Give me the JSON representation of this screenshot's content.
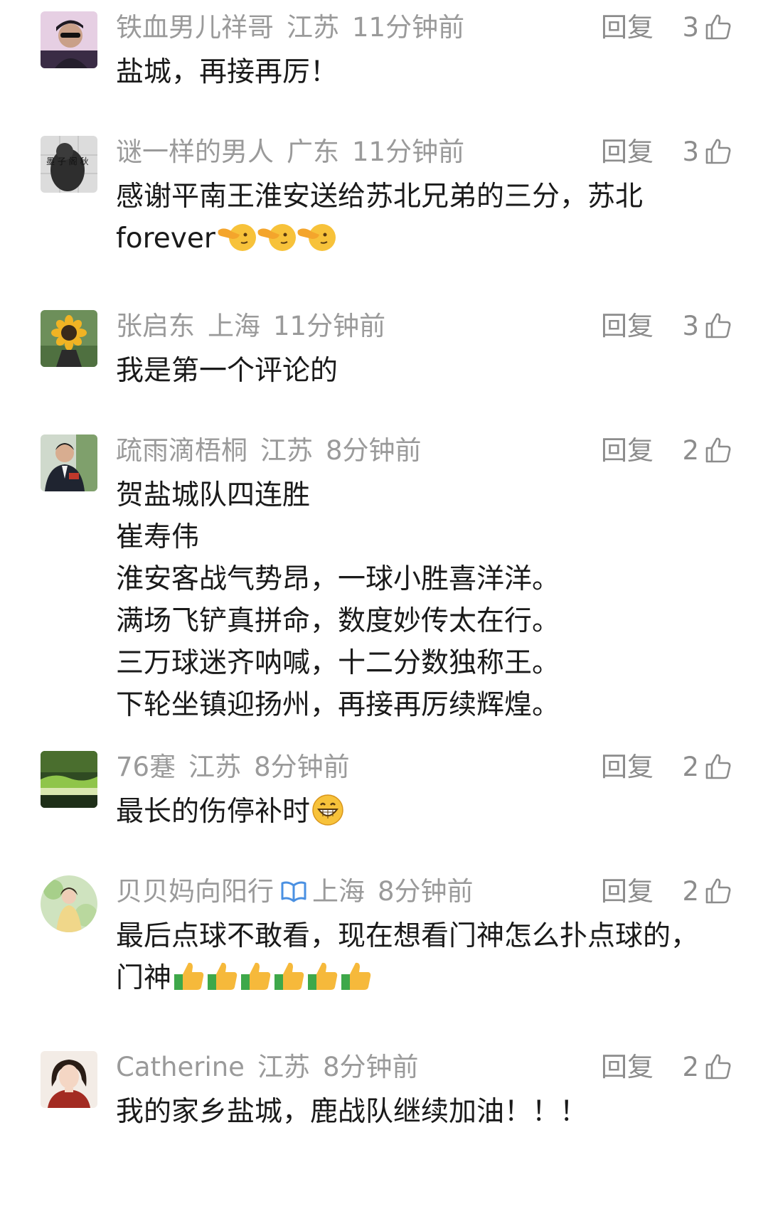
{
  "comments": [
    {
      "user": "铁血男儿祥哥",
      "location": "江苏",
      "time": "11分钟前",
      "reply_label": "回复",
      "likes": "3",
      "lines": [
        "盐城，再接再厉！"
      ]
    },
    {
      "user": "谜一样的男人",
      "location": "广东",
      "time": "11分钟前",
      "reply_label": "回复",
      "likes": "3",
      "lines": [
        "感谢平南王淮安送给苏北兄弟的三分，苏北",
        "forever"
      ],
      "emoji": "pointing-face-emoji ×3"
    },
    {
      "user": "张启东",
      "location": "上海",
      "time": "11分钟前",
      "reply_label": "回复",
      "likes": "3",
      "lines": [
        "我是第一个评论的"
      ]
    },
    {
      "user": "疏雨滴梧桐",
      "location": "江苏",
      "time": "8分钟前",
      "reply_label": "回复",
      "likes": "2",
      "lines": [
        "贺盐城队四连胜",
        "崔寿伟",
        "淮安客战气势昂，一球小胜喜洋洋。",
        "满场飞铲真拼命，数度妙传太在行。",
        "三万球迷齐呐喊，十二分数独称王。",
        "下轮坐镇迎扬州，再接再厉续辉煌。"
      ]
    },
    {
      "user": "76蹇",
      "location": "江苏",
      "time": "8分钟前",
      "reply_label": "回复",
      "likes": "2",
      "lines": [
        "最长的伤停补时"
      ],
      "emoji": "grinning-face-emoji"
    },
    {
      "user": "贝贝妈向阳行",
      "location": "上海",
      "time": "8分钟前",
      "reply_label": "回复",
      "likes": "2",
      "verified": true,
      "lines": [
        "最后点球不敢看，现在想看门神怎么扑点球的，",
        "门神"
      ],
      "emoji": "thumbs-up-emoji ×6"
    },
    {
      "user": "Catherine",
      "location": "江苏",
      "time": "8分钟前",
      "reply_label": "回复",
      "likes": "2",
      "lines": [
        "我的家乡盐城，鹿战队继续加油！！！"
      ]
    }
  ],
  "colors": {
    "meta_text": "#9a9a9a",
    "body_text": "#1a1a1a",
    "verified_badge": "#4a90e2"
  }
}
